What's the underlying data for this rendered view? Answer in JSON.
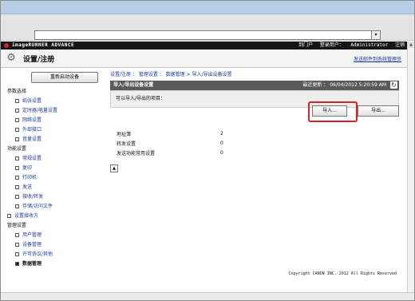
{
  "browser": {
    "address_value": "",
    "dropdown_glyph": "▾"
  },
  "brand": {
    "product": "imageRUNNER ADVANCE",
    "portal_link": "到门户",
    "login_label": "登录用户：",
    "login_user": "Administrator",
    "logout": "注销"
  },
  "header": {
    "title": "设置/注册",
    "icon": "gear-icon",
    "email_link": "发送邮件到系统管理员"
  },
  "sidebar": {
    "restart_button": "重新启动设备",
    "items": [
      {
        "label": "参数选择",
        "type": "group"
      },
      {
        "label": "纸张设置",
        "type": "sub"
      },
      {
        "label": "定时器/电量设置",
        "type": "sub"
      },
      {
        "label": "网络设置",
        "type": "sub"
      },
      {
        "label": "外部接口",
        "type": "sub"
      },
      {
        "label": "音量设置",
        "type": "sub"
      },
      {
        "label": "功能设置",
        "type": "group"
      },
      {
        "label": "常规设置",
        "type": "sub"
      },
      {
        "label": "复印",
        "type": "sub"
      },
      {
        "label": "打印机",
        "type": "sub"
      },
      {
        "label": "发送",
        "type": "sub"
      },
      {
        "label": "接收/转发",
        "type": "sub"
      },
      {
        "label": "存储/访问文件",
        "type": "sub"
      },
      {
        "label": "设置接收方",
        "type": "top"
      },
      {
        "label": "管理设置",
        "type": "group"
      },
      {
        "label": "用户管理",
        "type": "sub"
      },
      {
        "label": "设备管理",
        "type": "sub"
      },
      {
        "label": "许可协议/其他",
        "type": "sub"
      },
      {
        "label": "数据管理",
        "type": "current"
      }
    ]
  },
  "main": {
    "breadcrumb": "设置/注册 ： 管理设置 ： 数据管理 > 导入/导出设备设置",
    "panel_title": "导入/导出设备设置",
    "last_updated": "最近更新 ： 06/04/2012 5:20:59 AM",
    "question": "可以导入/导出的项目：",
    "import_button": "导入...",
    "export_button": "导出...",
    "rows": [
      {
        "label": "地址簿",
        "value": "2"
      },
      {
        "label": "转发设置",
        "value": "0"
      },
      {
        "label": "发送功能常用设置",
        "value": "0"
      }
    ],
    "copyright": "Copyright CANON INC. 2012 All Rights Reserved"
  },
  "colors": {
    "brand_bar": "#151515",
    "panel_header": "#595959",
    "link": "#1a3a9a",
    "highlight": "#d0262a"
  }
}
